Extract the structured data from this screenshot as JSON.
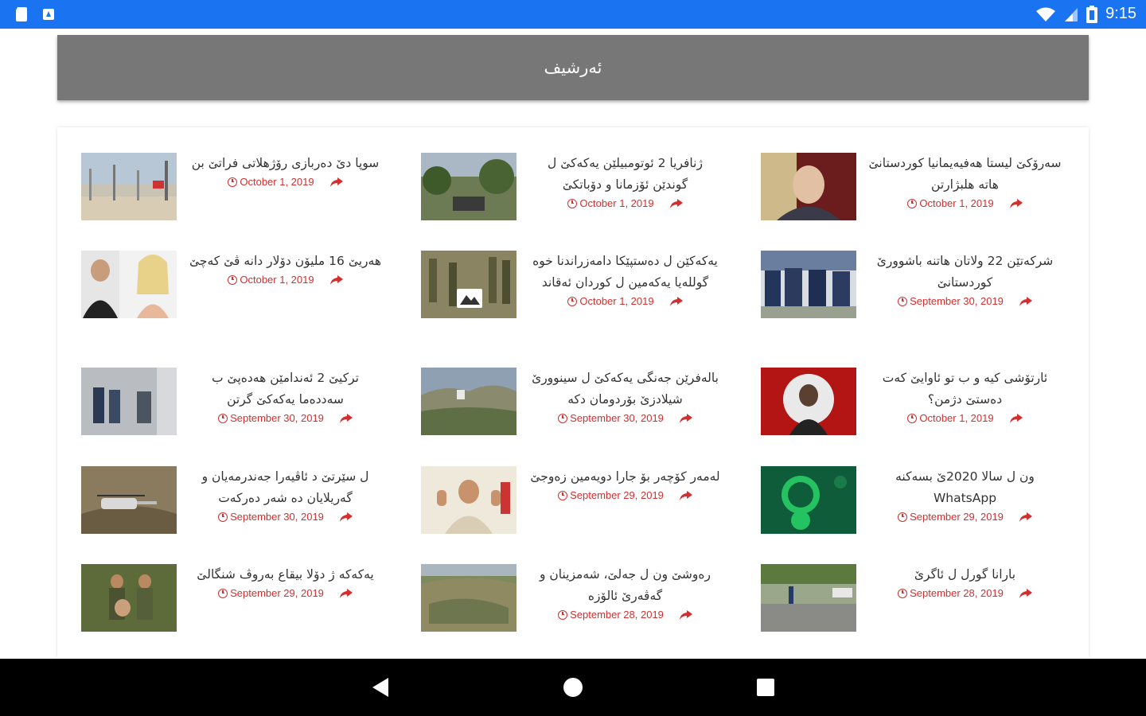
{
  "status_bar": {
    "time": "9:15",
    "left_icons": [
      "sd-card-icon",
      "notification-icon"
    ],
    "right_icons": [
      "wifi-icon",
      "cellular-signal-icon",
      "battery-icon"
    ]
  },
  "app_bar": {
    "title": "ئەرشیف"
  },
  "colors": {
    "status_bar": "#1a73f0",
    "app_bar": "#777777",
    "date": "#d32f2f",
    "nav_bar": "#000000"
  },
  "articles": [
    {
      "headline": "سوپا دێ دەربازی رۆژهلاتی فراتێ بن",
      "date": "October 1, 2019"
    },
    {
      "headline": "ژنافریا 2 ئوتومبیلێن یەکەکێ ل گوندێن ئۆزمانا و دۆباتکێ",
      "date": "October 1, 2019"
    },
    {
      "headline": "سەرۆکێ لیستا هەفیەیمانیا کوردستانێ هاتە هلبژارتن",
      "date": "October 1, 2019"
    },
    {
      "headline": "هەریێ 16 ملیۆن دۆلار دانە ڤێ کەچێ",
      "date": "October 1, 2019"
    },
    {
      "headline": "یەکەکێن ل دەستپێکا دامەزراندنا خوە گوللەیا یەکەمین ل کوردان ئەقاند",
      "date": "October 1, 2019"
    },
    {
      "headline": "شرکەتێن 22 ولاتان هاتنە باشوورێ کوردستانێ",
      "date": "September 30, 2019"
    },
    {
      "headline": "ترکیێ 2 ئەندامێن هەدەپێ ب سەددەما یەکەکێ گرتن",
      "date": "September 30, 2019"
    },
    {
      "headline": "بالەفرێن جەنگی یەکەکێ ل سینوورێ شیلادزێ بۆردومان دکە",
      "date": "September 30, 2019"
    },
    {
      "headline": "ئارتۆشی کیە و ب تو ئاوایێ کەت دەستێ دژمن؟",
      "date": "October 1, 2019"
    },
    {
      "headline": "ل سێرتێ د ئاڤیەرا جەندرمەیان و گەریلایان دە شەر دەرکەت",
      "date": "September 30, 2019"
    },
    {
      "headline": "لەمەر کۆچەر بۆ جارا دویەمین زەوجێ",
      "date": "September 29, 2019"
    },
    {
      "headline": "ون ل سالا 2020ێ بسەکنە WhatsApp",
      "date": "September 29, 2019"
    },
    {
      "headline": "یەکەکە ژ دۆلا بیقاع بەروڤ شنگالێ",
      "date": "September 29, 2019"
    },
    {
      "headline": "رەوشێ ون ل جەلێ، شەمزینان و گەڤەرێ ئالۆزە",
      "date": "September 28, 2019"
    },
    {
      "headline": "بارانا گورل ل ئاگرێ",
      "date": "September 28, 2019"
    }
  ],
  "nav_bar": {
    "buttons": [
      "back-icon",
      "home-icon",
      "recents-icon"
    ]
  }
}
